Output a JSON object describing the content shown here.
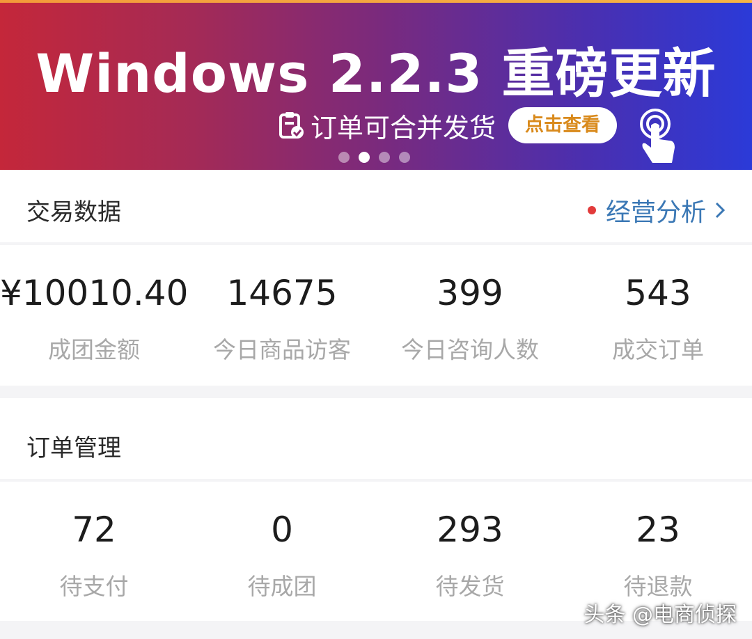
{
  "banner": {
    "title": "Windows 2.2.3 重磅更新",
    "subtitle": "订单可合并发货",
    "button_label": "点击查看",
    "slides": 4,
    "active_slide": 2
  },
  "trade": {
    "title": "交易数据",
    "link_label": "经营分析",
    "stats": [
      {
        "value": "¥10010.40",
        "label": "成团金额"
      },
      {
        "value": "14675",
        "label": "今日商品访客"
      },
      {
        "value": "399",
        "label": "今日咨询人数"
      },
      {
        "value": "543",
        "label": "成交订单"
      }
    ]
  },
  "orders": {
    "title": "订单管理",
    "stats": [
      {
        "value": "72",
        "label": "待支付"
      },
      {
        "value": "0",
        "label": "待成团"
      },
      {
        "value": "293",
        "label": "待发货"
      },
      {
        "value": "23",
        "label": "待退款"
      }
    ]
  },
  "watermark": "头条 @电商侦探",
  "colors": {
    "accent_link": "#3b78b5",
    "notice_dot": "#e23b3b",
    "banner_button_text": "#d98a1c"
  }
}
